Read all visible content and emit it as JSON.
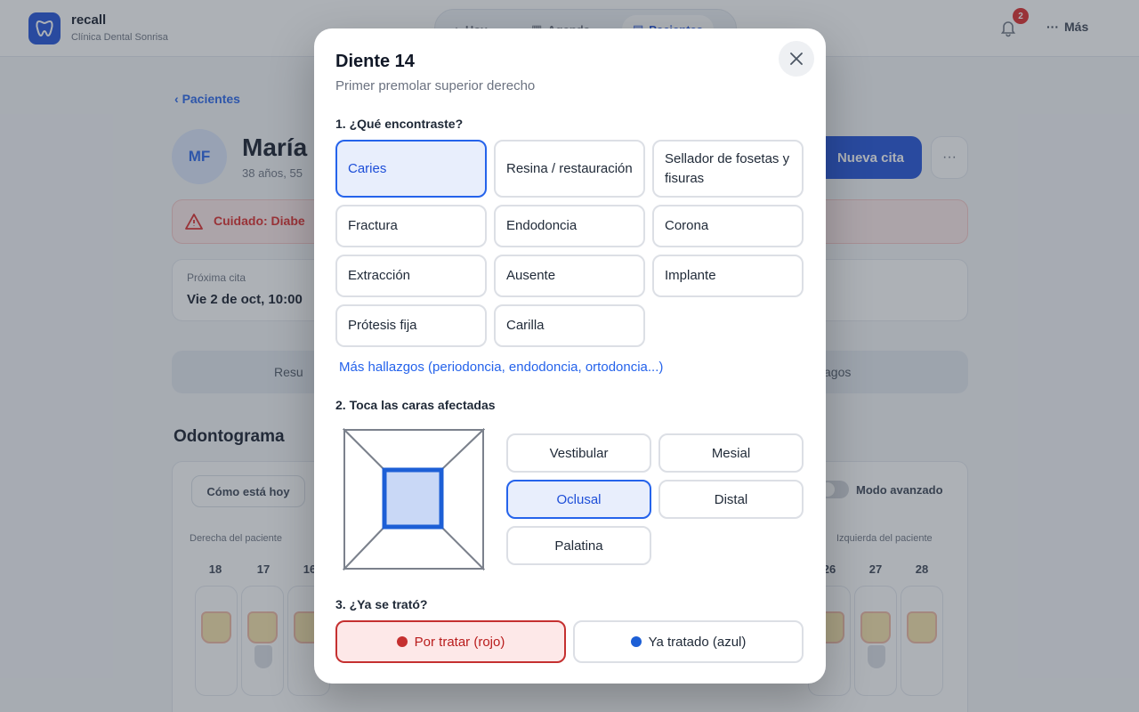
{
  "app": {
    "brand_name": "recall",
    "brand_sub": "Clínica Dental Sonrisa",
    "nav": [
      {
        "label": "Hoy"
      },
      {
        "label": "Agenda"
      },
      {
        "label": "Pacientes"
      }
    ],
    "notification_count": "2",
    "more_label": "Más"
  },
  "patient": {
    "back_label": "Pacientes",
    "initials": "MF",
    "name_visible": "María",
    "meta_visible": "38 años, 55",
    "new_appointment_label": "Nueva cita",
    "alert_visible": "Cuidado: Diabe",
    "next_appt_label": "Próxima cita",
    "next_appt_value": "Vie 2 de oct, 10:00",
    "tab_summary_visible": "Resu",
    "tab_payments_visible": "agos",
    "odontogram_title": "Odontograma",
    "today_label": "Cómo está hoy",
    "advanced_mode_label": "Modo avanzado",
    "side_right_label": "Derecha del paciente",
    "side_left_label": "Izquierda del paciente",
    "teeth_left": [
      "18",
      "17",
      "16"
    ],
    "teeth_right": [
      "26",
      "27",
      "28"
    ]
  },
  "modal": {
    "title": "Diente 14",
    "subtitle": "Primer premolar superior derecho",
    "section1": "1. ¿Qué encontraste?",
    "findings": [
      {
        "label": "Caries",
        "selected": true
      },
      {
        "label": "Resina / restauración",
        "selected": false
      },
      {
        "label": "Sellador de fosetas y fisuras",
        "selected": false
      },
      {
        "label": "Fractura",
        "selected": false
      },
      {
        "label": "Endodoncia",
        "selected": false
      },
      {
        "label": "Corona",
        "selected": false
      },
      {
        "label": "Extracción",
        "selected": false
      },
      {
        "label": "Ausente",
        "selected": false
      },
      {
        "label": "Implante",
        "selected": false
      },
      {
        "label": "Prótesis fija",
        "selected": false
      },
      {
        "label": "Carilla",
        "selected": false
      }
    ],
    "more_findings": "Más hallazgos (periodoncia, endodoncia, ortodoncia...)",
    "section2": "2. Toca las caras afectadas",
    "faces": [
      {
        "label": "Vestibular",
        "selected": false
      },
      {
        "label": "Mesial",
        "selected": false
      },
      {
        "label": "Oclusal",
        "selected": true
      },
      {
        "label": "Distal",
        "selected": false
      },
      {
        "label": "Palatina",
        "selected": false
      }
    ],
    "section3": "3. ¿Ya se trató?",
    "status_untreated": "Por tratar (rojo)",
    "status_treated": "Ya tratado (azul)"
  },
  "colors": {
    "accent": "#2563eb",
    "accent_dark": "#1d4ed8",
    "selected_bg": "#e8eefc",
    "untreated": "#dc2626",
    "treated": "#1d5fd6"
  }
}
